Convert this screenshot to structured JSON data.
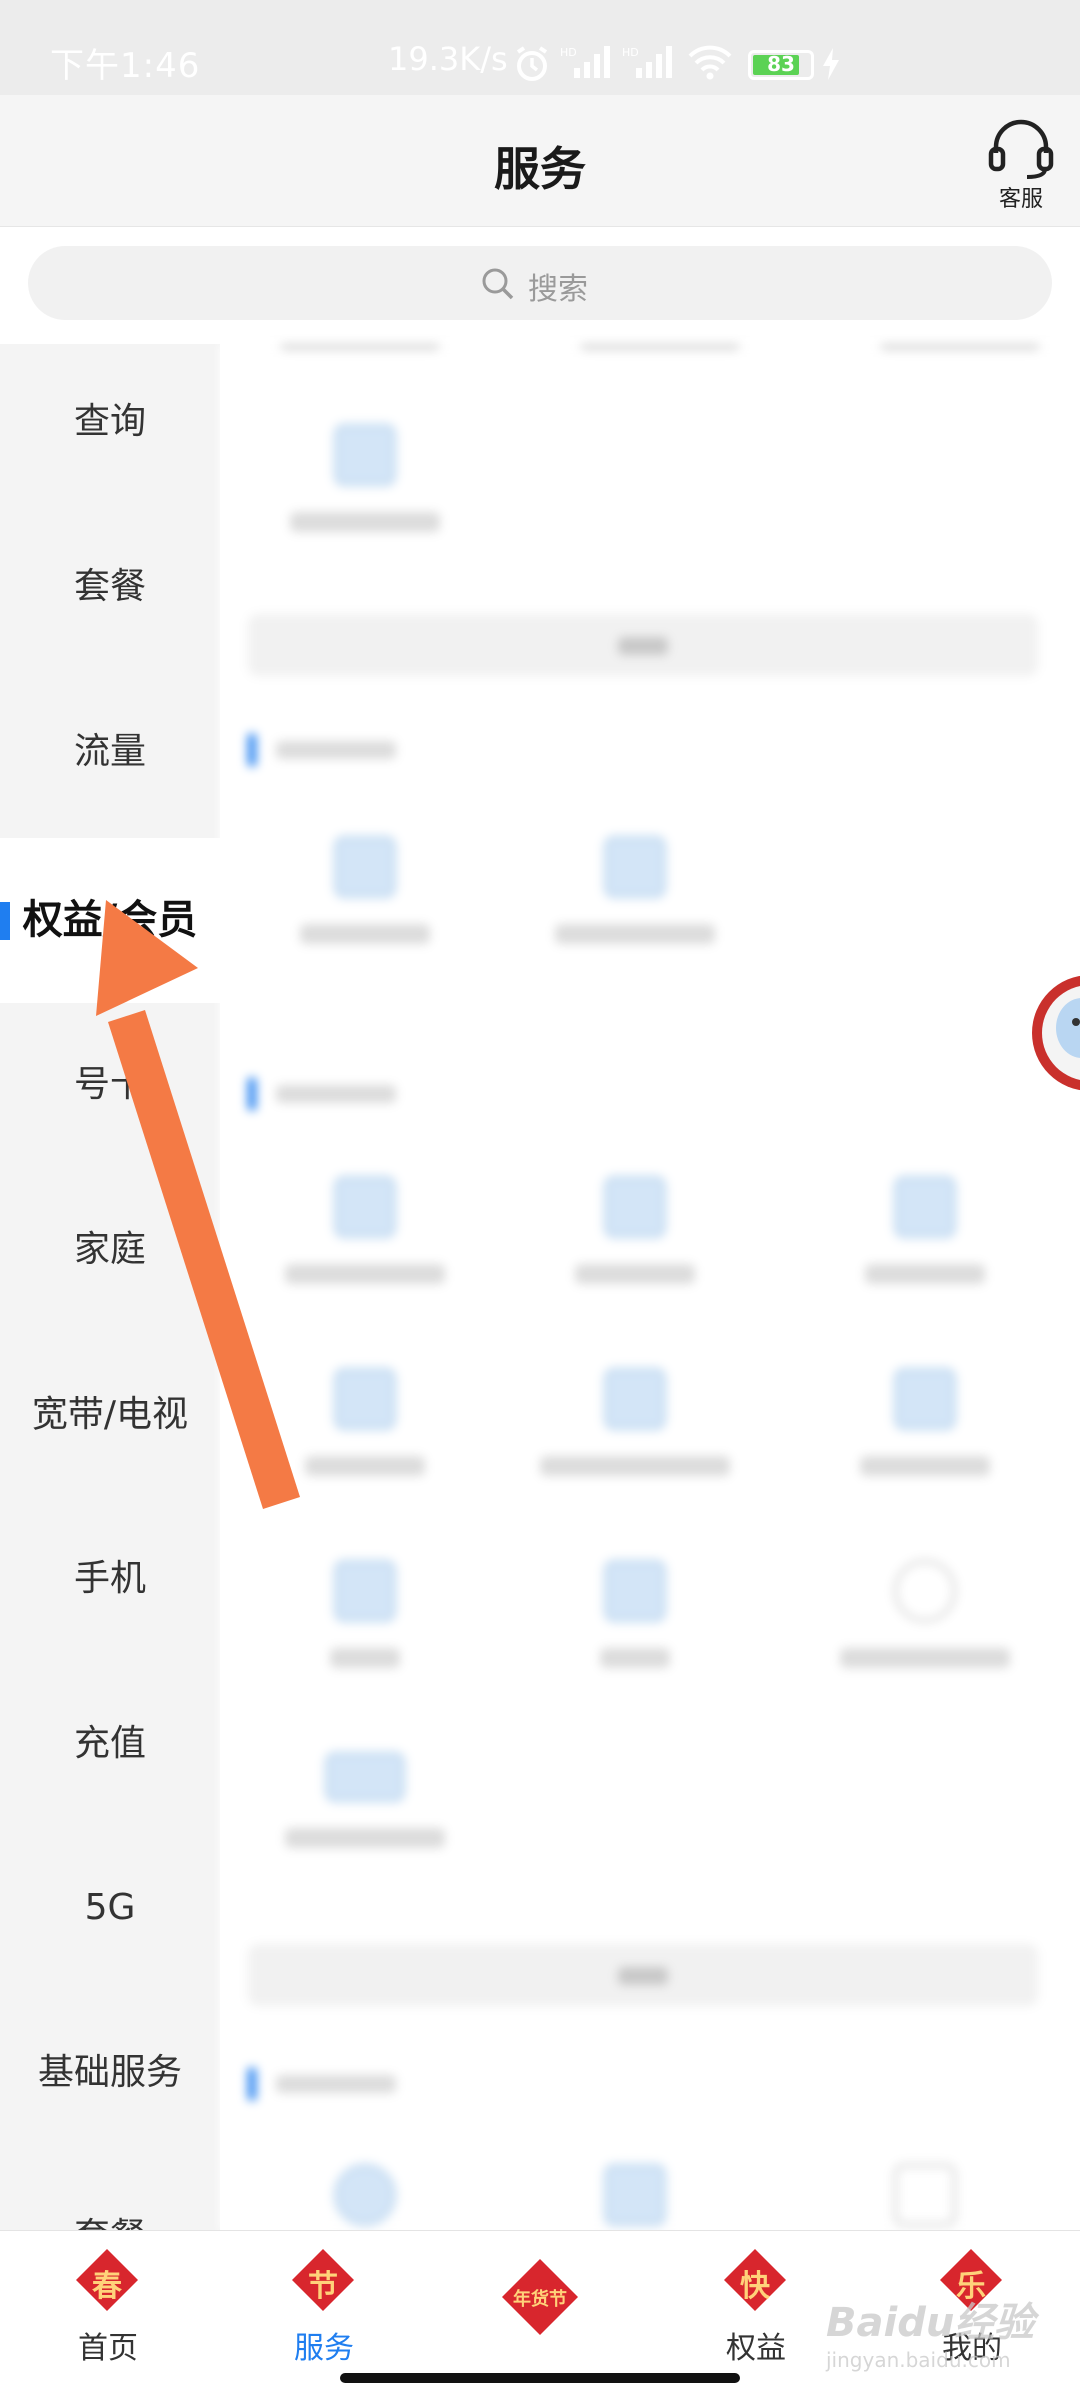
{
  "status_bar": {
    "time": "下午1:46",
    "net_speed": "19.3K/s",
    "battery_level": "83",
    "icons": [
      "alarm-icon",
      "hd-signal-icon",
      "hd-signal-icon",
      "wifi-icon",
      "battery-icon",
      "charging-icon"
    ]
  },
  "header": {
    "title": "服务",
    "customer_service_label": "客服",
    "customer_service_icon": "headset-icon"
  },
  "search": {
    "placeholder": "搜索"
  },
  "sidebar": {
    "items": [
      {
        "label": "查询",
        "active": false
      },
      {
        "label": "套餐",
        "active": false
      },
      {
        "label": "流量",
        "active": false
      },
      {
        "label": "权益/会员",
        "active": true
      },
      {
        "label": "号卡",
        "active": false
      },
      {
        "label": "家庭",
        "active": false
      },
      {
        "label": "宽带/电视",
        "active": false
      },
      {
        "label": "手机",
        "active": false
      },
      {
        "label": "充值",
        "active": false
      },
      {
        "label": "5G",
        "active": false
      },
      {
        "label": "基础服务",
        "active": false
      },
      {
        "label": "套餐",
        "active": false
      }
    ]
  },
  "bottom_nav": {
    "items": [
      {
        "label": "首页",
        "badge": "春",
        "active": false
      },
      {
        "label": "服务",
        "badge": "节",
        "active": true
      },
      {
        "label": "",
        "badge": "年货节",
        "active": false
      },
      {
        "label": "权益",
        "badge": "快",
        "active": false
      },
      {
        "label": "我的",
        "badge": "乐",
        "active": false
      }
    ]
  },
  "watermark": {
    "main": "Baidu经验",
    "sub": "jingyan.baidu.com"
  },
  "colors": {
    "accent": "#1f7ef0",
    "arrow": "#f47a45",
    "badge_red": "#d8262d",
    "sidebar_bg": "#f4f4f4"
  }
}
